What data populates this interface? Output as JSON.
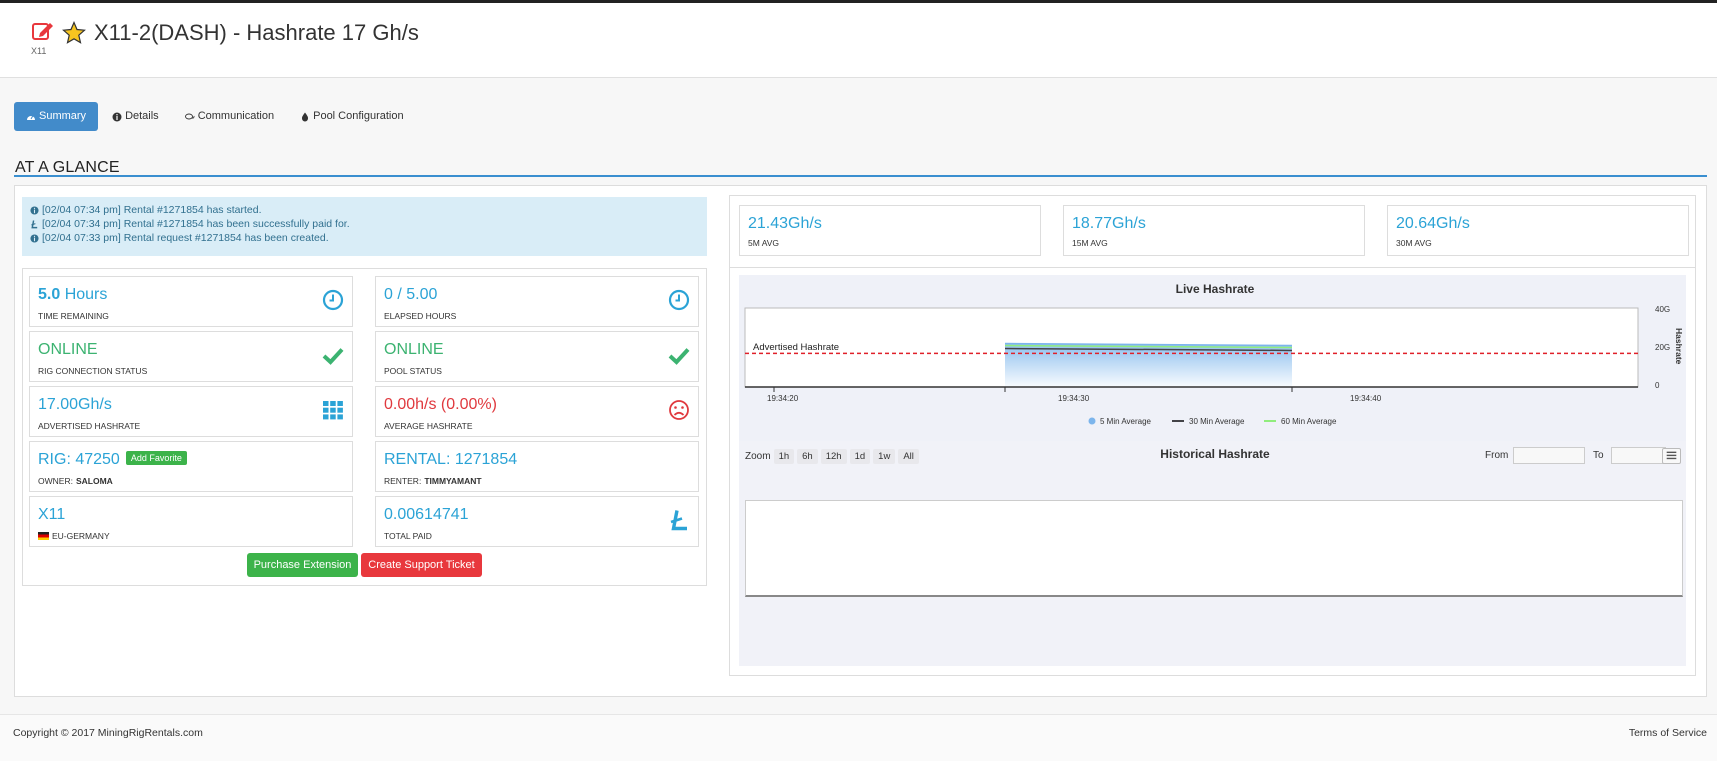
{
  "header": {
    "title": "X11-2(DASH) - Hashrate 17 Gh/s",
    "algo": "X11"
  },
  "tabs": [
    {
      "label": "Summary",
      "icon": "dashboard-icon",
      "active": true
    },
    {
      "label": "Details",
      "icon": "info-icon"
    },
    {
      "label": "Communication",
      "icon": "comments-icon"
    },
    {
      "label": "Pool Configuration",
      "icon": "tint-icon"
    }
  ],
  "section_title": "AT A GLANCE",
  "alerts": [
    {
      "icon": "info-icon",
      "text": "[02/04 07:34 pm] Rental #1271854 has started."
    },
    {
      "icon": "litecoin-icon",
      "text": "[02/04 07:34 pm] Rental #1271854 has been successfully paid for."
    },
    {
      "icon": "info-icon",
      "text": "[02/04 07:33 pm] Rental request #1271854 has been created."
    }
  ],
  "cells": {
    "time_remaining": {
      "value_bold": "5.0",
      "value_rest": " Hours",
      "label": "TIME REMAINING"
    },
    "elapsed_hours": {
      "value": "0 / 5.00",
      "label": "ELAPSED HOURS"
    },
    "rig_connection": {
      "value": "ONLINE",
      "label": "RIG CONNECTION STATUS"
    },
    "pool_status": {
      "value": "ONLINE",
      "label": "POOL STATUS"
    },
    "advertised_hashrate": {
      "value": "17.00Gh/s",
      "label": "ADVERTISED HASHRATE"
    },
    "average_hashrate": {
      "value": "0.00h/s (0.00%)",
      "label": "AVERAGE HASHRATE"
    },
    "rig": {
      "value": "RIG: 47250",
      "button": "Add Favorite",
      "label_prefix": "OWNER:",
      "label_value": "SALOMA"
    },
    "rental": {
      "value": "RENTAL: 1271854",
      "label_prefix": "RENTER:",
      "label_value": "TIMMYAMANT"
    },
    "region": {
      "value": "X11",
      "label": "EU-GERMANY"
    },
    "total_paid": {
      "value": "0.00614741",
      "label": "TOTAL PAID"
    }
  },
  "buttons": {
    "purchase_extension": "Purchase Extension",
    "create_ticket": "Create Support Ticket"
  },
  "averages": [
    {
      "value": "21.43Gh/s",
      "label": "5M AVG"
    },
    {
      "value": "18.77Gh/s",
      "label": "15M AVG"
    },
    {
      "value": "20.64Gh/s",
      "label": "30M AVG"
    }
  ],
  "live_chart": {
    "title": "Live Hashrate",
    "advertised_label": "Advertised Hashrate",
    "y_axis_title": "Hashrate",
    "y_ticks": [
      "40G",
      "20G",
      "0"
    ],
    "x_ticks": [
      "19:34:20",
      "19:34:30",
      "19:34:40"
    ],
    "legend": [
      "5 Min Average",
      "30 Min Average",
      "60 Min Average"
    ]
  },
  "chart_data": {
    "type": "area",
    "title": "Live Hashrate",
    "ylabel": "Hashrate",
    "ylim": [
      0,
      40
    ],
    "yunit": "G",
    "x": [
      "19:34:20",
      "19:34:30",
      "19:34:40"
    ],
    "advertised_hashrate": 17,
    "series": [
      {
        "name": "5 Min Average",
        "color": "#7cb5ec",
        "x": [
          "19:34:30",
          "19:34:40"
        ],
        "values": [
          22,
          21
        ]
      },
      {
        "name": "30 Min Average",
        "color": "#434348",
        "x": [
          "19:34:30",
          "19:34:40"
        ],
        "values": [
          19.5,
          18.5
        ]
      },
      {
        "name": "60 Min Average",
        "color": "#90ed7d",
        "x": [
          "19:34:30",
          "19:34:40"
        ],
        "values": [
          21,
          20
        ]
      }
    ],
    "legend_position": "bottom"
  },
  "historical": {
    "title": "Historical Hashrate",
    "zoom_label": "Zoom",
    "zoom_options": [
      "1h",
      "6h",
      "12h",
      "1d",
      "1w",
      "All"
    ],
    "from_label": "From",
    "to_label": "To"
  },
  "footer": {
    "copyright": "Copyright © 2017 MiningRigRentals.com",
    "terms": "Terms of Service"
  },
  "colors": {
    "accent": "#2ba3d6",
    "online": "#3cb371",
    "error": "#e0393e",
    "primary_tab": "#428bca"
  }
}
